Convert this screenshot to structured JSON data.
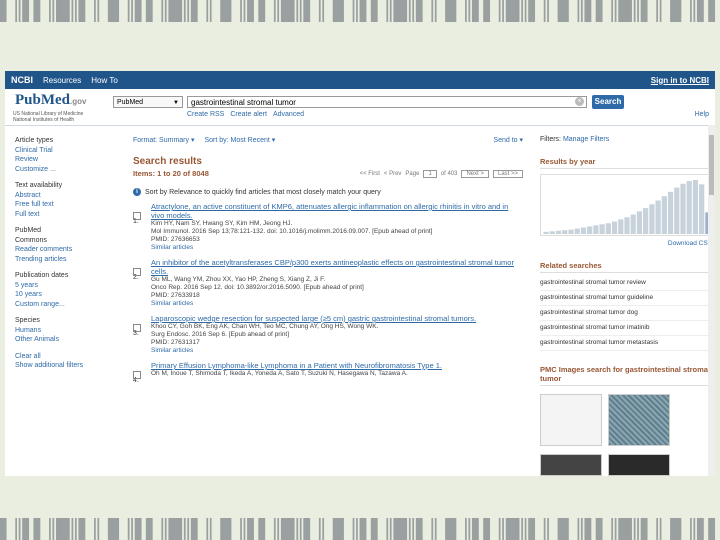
{
  "barcode_text": "▌║▌▌║█║▌║▐▌║▌▌║█║▌║▐▌║▌▌║█║▌║▐▌║▌▌║█║▌║▐▌║▌▌║█║▌║▐▌║▌▌║█║▌║▐▌║▌▌║█║▌║▐▌║▌▌║█║▌║",
  "ncbi": {
    "logo": "NCBI",
    "resources": "Resources",
    "howto": "How To",
    "signin": "Sign in to NCBI"
  },
  "pubmed": {
    "logo": "PubMed",
    "gov": ".gov",
    "sub1": "US National Library of Medicine",
    "sub2": "National Institutes of Health",
    "db": "PubMed",
    "query": "gastrointestinal stromal tumor",
    "search": "Search",
    "create_rss": "Create RSS",
    "create_alert": "Create alert",
    "advanced": "Advanced",
    "help": "Help"
  },
  "left": {
    "g1": [
      "Article types",
      "Clinical Trial",
      "Review",
      "Customize ..."
    ],
    "g2": [
      "Text availability",
      "Abstract",
      "Free full text",
      "Full text"
    ],
    "g3": [
      "PubMed",
      "Commons",
      "Reader comments",
      "Trending articles"
    ],
    "g4": [
      "Publication dates",
      "5 years",
      "10 years",
      "Custom range..."
    ],
    "g5": [
      "Species",
      "Humans",
      "Other Animals"
    ],
    "g6": [
      "Clear all",
      "Show additional filters"
    ]
  },
  "main": {
    "format": "Format: Summary ▾",
    "sortby": "Sort by: Most Recent ▾",
    "sendto": "Send to ▾",
    "heading": "Search results",
    "items": "Items: 1 to 20 of 8048",
    "pager": {
      "first": "<< First",
      "prev": "< Prev",
      "page": "Page",
      "pagenum": "1",
      "of": "of 403",
      "next": "Next >",
      "last": "Last >>"
    },
    "sortnote": "Sort by Relevance to quickly find articles that most closely match your query",
    "results": [
      {
        "n": "1.",
        "title": "Atractylone, an active constituent of KMP6, attenuates allergic inflammation on allergic rhinitis in vitro and in vivo models.",
        "authors": "Kim HY, Nam SY, Hwang SY, Kim HM, Jeong HJ.",
        "src": "Mol Immunol. 2016 Sep 13;78:121-132. doi: 10.1016/j.molimm.2016.09.007. [Epub ahead of print]",
        "pmid": "PMID: 27636653",
        "similar": "Similar articles"
      },
      {
        "n": "2.",
        "title": "An inhibitor of the acetyltransferases CBP/p300 exerts antineoplastic effects on gastrointestinal stromal tumor cells.",
        "authors": "Gu ML, Wang YM, Zhou XX, Yao HP, Zheng S, Xiang Z, Ji F.",
        "src": "Onco Rep. 2016 Sep 12. doi: 10.3892/or.2016.5090. [Epub ahead of print]",
        "pmid": "PMID: 27633918",
        "similar": "Similar articles"
      },
      {
        "n": "3.",
        "title": "Laparoscopic wedge resection for suspected large (≥5 cm) gastric gastrointestinal stromal tumors.",
        "authors": "Khoo CY, Goh BK, Eng AK, Chan WH, Teo MC, Chung AY, Ong HS, Wong WK.",
        "src": "Surg Endosc. 2016 Sep 6. [Epub ahead of print]",
        "pmid": "PMID: 27631317",
        "similar": "Similar articles"
      },
      {
        "n": "4.",
        "title": "Primary Effusion Lymphoma-like Lymphoma in a Patient with Neurofibromatosis Type 1.",
        "authors": "Oh M, Inoue T, Shimoda T, Ikeda A, Yoneda A, Sato T, Suzuki N, Hasegawa N, Tazawa A.",
        "src": "",
        "pmid": "",
        "similar": ""
      }
    ]
  },
  "right": {
    "filters_label": "Filters:",
    "filters_link": "Manage Filters",
    "results_by_year": "Results by year",
    "download_csv": "Download CSV",
    "year_bars": [
      0.04,
      0.05,
      0.06,
      0.07,
      0.08,
      0.1,
      0.12,
      0.14,
      0.16,
      0.18,
      0.2,
      0.23,
      0.27,
      0.31,
      0.36,
      0.42,
      0.48,
      0.55,
      0.62,
      0.7,
      0.78,
      0.86,
      0.93,
      0.98,
      1.0,
      0.92,
      0.4
    ],
    "related_heading": "Related searches",
    "related": [
      "gastrointestinal stromal tumor review",
      "gastrointestinal stromal tumor guideline",
      "gastrointestinal stromal tumor dog",
      "gastrointestinal stromal tumor imatinib",
      "gastrointestinal stromal tumor metastasis"
    ],
    "pmc_heading": "PMC Images search for gastrointestinal stromal tumor"
  },
  "colors": {
    "ncbi_bar": "#20558a",
    "link": "#2e6aa8",
    "heading": "#985735",
    "slide_bg": "#e9eee0"
  }
}
